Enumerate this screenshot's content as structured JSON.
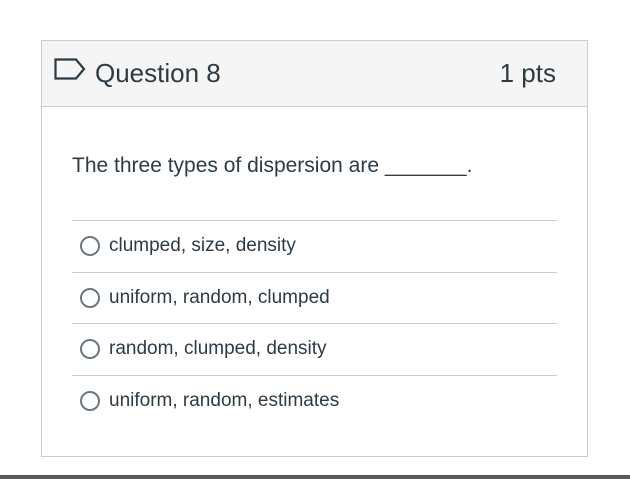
{
  "question": {
    "title": "Question 8",
    "points": "1 pts",
    "text": "The three types of dispersion are _______.",
    "flag_icon": "flag-outline-icon"
  },
  "answers": [
    {
      "label": "clumped, size, density"
    },
    {
      "label": "uniform, random, clumped"
    },
    {
      "label": "random, clumped, density"
    },
    {
      "label": "uniform, random, estimates"
    }
  ],
  "colors": {
    "header_bg": "#f5f5f5",
    "border": "#c7cdd1",
    "text": "#2d3b45"
  }
}
